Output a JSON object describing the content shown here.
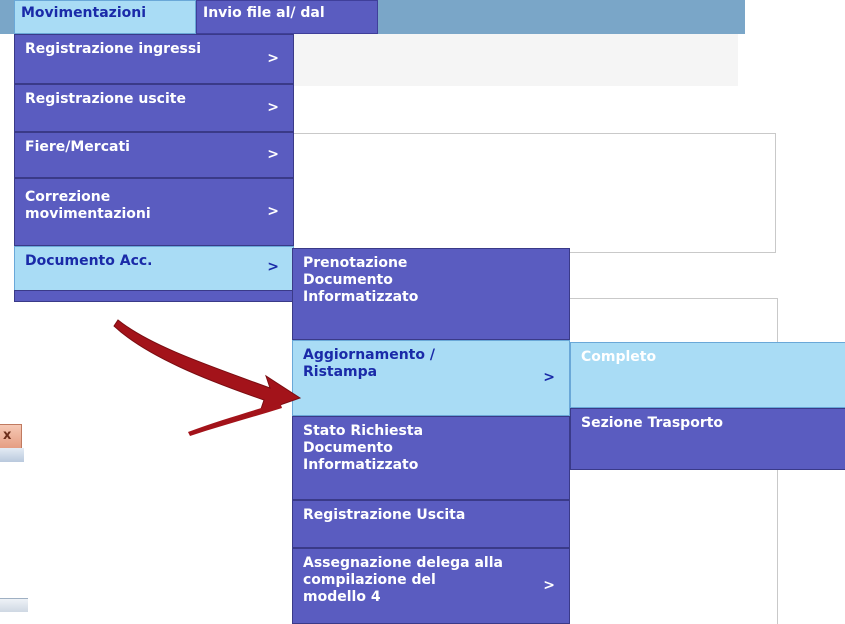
{
  "menubar": {
    "items": [
      {
        "label": "Movimentazioni",
        "active": true
      },
      {
        "label": "Invio file al/ dal",
        "active": false
      }
    ]
  },
  "column1": {
    "items": [
      {
        "label": "Registrazione ingressi",
        "submenu": ">"
      },
      {
        "label": "Registrazione uscite",
        "submenu": ">"
      },
      {
        "label": "Fiere/Mercati",
        "submenu": ">"
      },
      {
        "label": "Correzione movimentazioni",
        "submenu": ">"
      },
      {
        "label": "Documento Acc.",
        "submenu": ">",
        "highlighted": true
      }
    ]
  },
  "column2": {
    "items": [
      {
        "label": "Prenotazione Documento Informatizzato"
      },
      {
        "label": "Aggiornamento / Ristampa",
        "submenu": ">",
        "highlighted": true
      },
      {
        "label": "Stato Richiesta Documento Informatizzato"
      },
      {
        "label": "Registrazione Uscita"
      },
      {
        "label": "Assegnazione delega alla compilazione del modello 4",
        "submenu": ">"
      }
    ]
  },
  "column3": {
    "items": [
      {
        "label": "Completo",
        "highlighted": true
      },
      {
        "label": "Sezione Trasporto"
      }
    ]
  },
  "window": {
    "close_glyph": "x"
  },
  "annotation": {
    "color": "#a3131a",
    "icon": "curved-arrow-icon"
  },
  "colors": {
    "menu_bg": "#5a5cc0",
    "menu_highlight": "#a9dcf5",
    "menu_highlight_text": "#1a2aa8"
  }
}
